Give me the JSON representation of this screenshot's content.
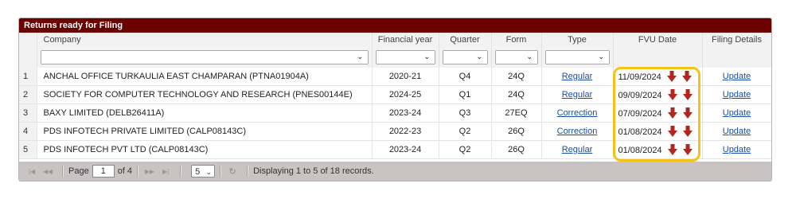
{
  "panel": {
    "title": "Returns ready for Filing"
  },
  "columns": {
    "company": "Company",
    "financial_year": "Financial year",
    "quarter": "Quarter",
    "form": "Form",
    "type": "Type",
    "fvu_date": "FVU Date",
    "filing_details": "Filing Details"
  },
  "rows": [
    {
      "num": "1",
      "company": "ANCHAL OFFICE TURKAULIA EAST CHAMPARAN (PTNA01904A)",
      "fy": "2020-21",
      "quarter": "Q4",
      "form": "24Q",
      "type": "Regular",
      "fvu": "11/09/2024",
      "action": "Update"
    },
    {
      "num": "2",
      "company": "SOCIETY FOR COMPUTER TECHNOLOGY AND RESEARCH (PNES00144E)",
      "fy": "2024-25",
      "quarter": "Q1",
      "form": "24Q",
      "type": "Regular",
      "fvu": "09/09/2024",
      "action": "Update"
    },
    {
      "num": "3",
      "company": "BAXY LIMITED (DELB26411A)",
      "fy": "2023-24",
      "quarter": "Q3",
      "form": "27EQ",
      "type": "Correction",
      "fvu": "07/09/2024",
      "action": "Update"
    },
    {
      "num": "4",
      "company": "PDS INFOTECH PRIVATE LIMITED (CALP08143C)",
      "fy": "2022-23",
      "quarter": "Q2",
      "form": "26Q",
      "type": "Correction",
      "fvu": "01/08/2024",
      "action": "Update"
    },
    {
      "num": "5",
      "company": "PDS INFOTECH PVT LTD (CALP08143C)",
      "fy": "2023-24",
      "quarter": "Q2",
      "form": "26Q",
      "type": "Regular",
      "fvu": "01/08/2024",
      "action": "Update"
    }
  ],
  "pager": {
    "page_label": "Page",
    "current_page": "1",
    "of_label": "of 4",
    "page_size": "5",
    "status": "Displaying 1 to 5 of 18 records."
  },
  "icons": {
    "download": "download-arrow-icon",
    "highlight_color": "#f5c218",
    "header_color": "#6b0000"
  }
}
